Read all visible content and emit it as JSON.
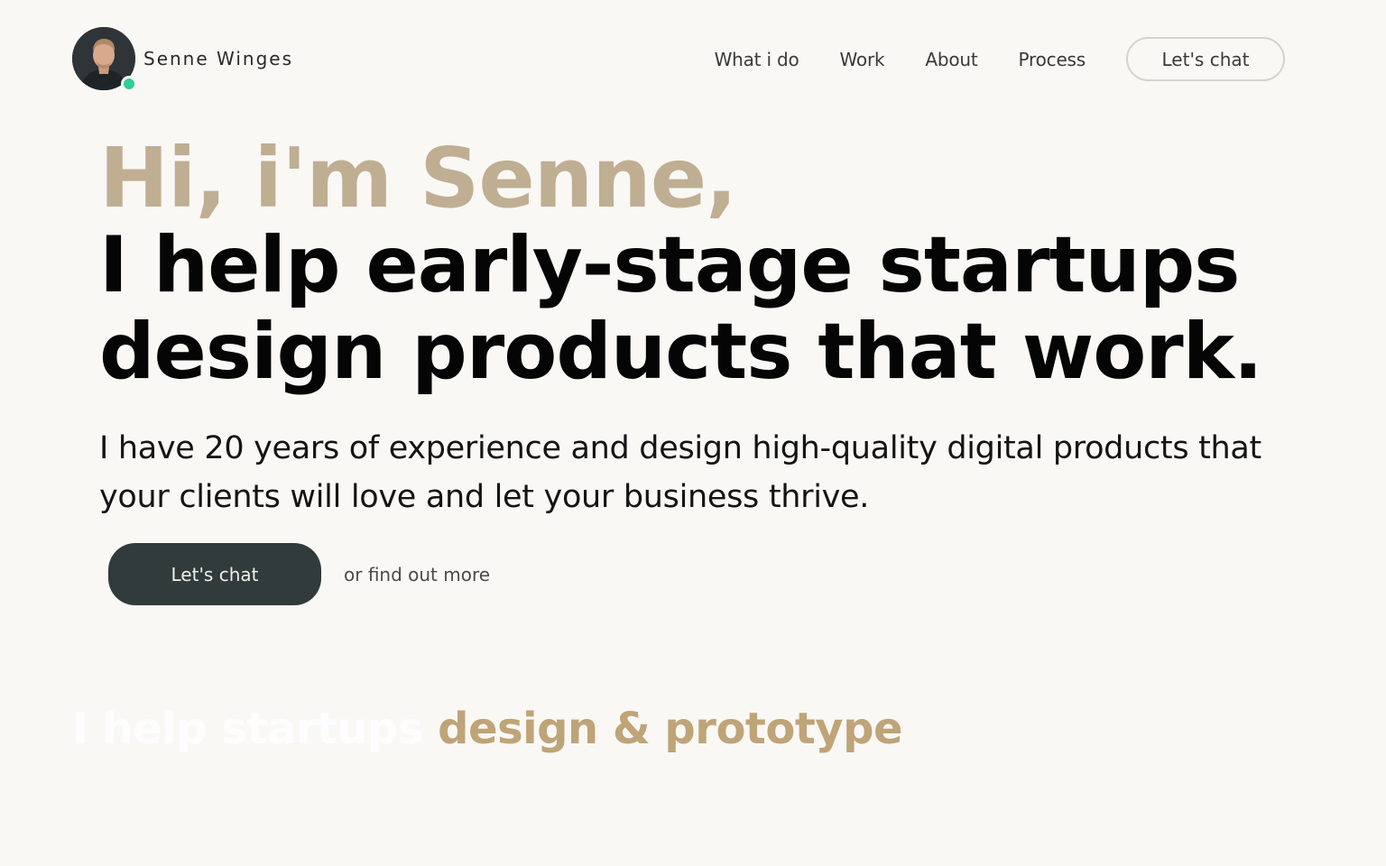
{
  "brand": {
    "name": "Senne Winges",
    "avatar_alt": "Senne Winges avatar",
    "status_color": "#2fcf9a"
  },
  "nav": {
    "items": [
      {
        "label": "What i do"
      },
      {
        "label": "Work"
      },
      {
        "label": "About"
      },
      {
        "label": "Process"
      }
    ],
    "cta_label": "Let's chat"
  },
  "hero": {
    "greeting": "Hi, i'm Senne,",
    "headline_line1": "I help early-stage startups",
    "headline_line2": "design products that work.",
    "subtitle": "I have 20 years of experience and design high-quality digital products that your clients will love and let your business thrive.",
    "primary_cta": "Let's chat",
    "secondary_cta": "or find out more"
  },
  "marquee": {
    "faded_text": "I help startups",
    "accent_text": "design & prototype"
  },
  "colors": {
    "background": "#f9f8f5",
    "greeting": "#bfae92",
    "headline": "#050505",
    "primary_button": "#313b3b",
    "accent": "#bfa478"
  }
}
